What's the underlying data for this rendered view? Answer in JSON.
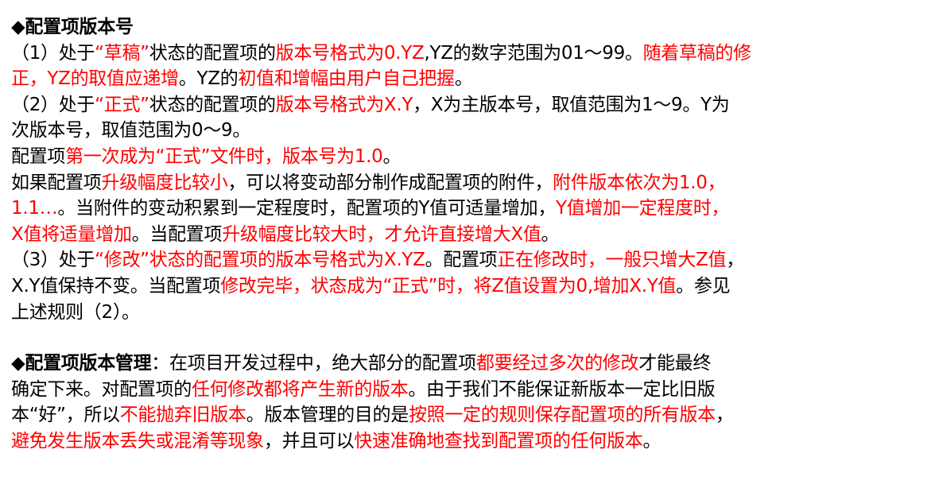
{
  "watermark": {
    "text": "",
    "color": "#dc5050"
  },
  "colors": {
    "text": "#000000",
    "highlight": "#ff0000"
  },
  "section1": {
    "bullet": "◆",
    "title": "配置项版本号"
  },
  "rule1": {
    "s1": "（1）处于",
    "s2": "“草稿”",
    "s3": "状态的配置项的",
    "s4": "版本号格式为0.YZ",
    "s5": ",YZ的数字范围为01～99。",
    "s6": "随着草稿的修",
    "s7": "正，YZ的取值应递增",
    "s8": "。YZ的",
    "s9": "初值和增幅由用户自己把握",
    "s10": "。"
  },
  "rule2": {
    "s1": "（2）处于",
    "s2": "“正式”",
    "s3": "状态的配置项的",
    "s4": "版本号格式为X.Y",
    "s5": "，X为主版本号，取值范围为1～9。Y为",
    "s6": "次版本号，取值范围为0～9。"
  },
  "rule2a": {
    "s1": "配置项",
    "s2": "第一次成为“正式”文件时，版本号为1.0",
    "s3": "。"
  },
  "rule2b": {
    "s1": "如果配置项",
    "s2": "升级幅度比较小",
    "s3": "，可以将变动部分制作成配置项的附件，",
    "s4": "附件版本依次为1.0，",
    "s5": "1.1…",
    "s6": "。当附件的变动积累到一定程度时，配置项的Y值可适量增加，",
    "s7": "Y值增加一定程度时，",
    "s8": "X值将适量增加",
    "s9": "。当配置项",
    "s10": "升级幅度比较大时，才允许直接增大X值",
    "s11": "。"
  },
  "rule3": {
    "s1": "（3）处于",
    "s2": "“修改”状态的配置项的版本号格式为X.YZ",
    "s3": "。配置项",
    "s4": "正在修改时，一般只增大Z值",
    "s5": "，",
    "s6": "X.Y值保持不变。当配置项",
    "s7": "修改完毕，状态成为“正式”时，将Z值设置为0,增加X.Y值",
    "s8": "。参见",
    "s9": "上述规则（2）。"
  },
  "section2": {
    "bullet": "◆",
    "title": "配置项版本管理",
    "p1": "：在项目开发过程中，绝大部分的配置项",
    "p2": "都要经过多次的修改",
    "p3": "才能最终",
    "p4": "确定下来。对配置项的",
    "p5": "任何修改都将产生新的版本",
    "p6": "。由于我们不能保证新版本一定比旧版",
    "p7": "本“好”，所以",
    "p8": "不能抛弃旧版本",
    "p9": "。版本管理的目的是",
    "p10": "按照一定的规则保存配置项的所有版本",
    "p11": "，",
    "p12": "避免发生版本丢失或混淆等现象",
    "p13": "，并且可以",
    "p14": "快速准确地查找到配置项的任何版本",
    "p15": "。"
  }
}
